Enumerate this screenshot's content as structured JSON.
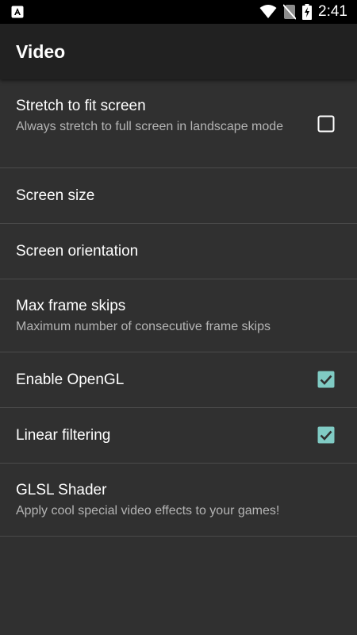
{
  "status_bar": {
    "left_icon": "app-notification-icon",
    "icons": [
      "wifi-icon",
      "no-sim-icon",
      "battery-charging-icon"
    ],
    "time": "2:41"
  },
  "app_bar": {
    "title": "Video"
  },
  "preferences": [
    {
      "title": "Stretch to fit screen",
      "summary": "Always stretch to full screen in landscape mode",
      "checkbox": true,
      "checked": false
    },
    {
      "title": "Screen size",
      "summary": ""
    },
    {
      "title": "Screen orientation",
      "summary": ""
    },
    {
      "title": "Max frame skips",
      "summary": "Maximum number of consecutive frame skips"
    },
    {
      "title": "Enable OpenGL",
      "summary": "",
      "checkbox": true,
      "checked": true
    },
    {
      "title": "Linear filtering",
      "summary": "",
      "checkbox": true,
      "checked": true
    },
    {
      "title": "GLSL Shader",
      "summary": "Apply cool special video effects to your games!"
    }
  ],
  "colors": {
    "background": "#303030",
    "app_bar": "#212121",
    "status_bar": "#000000",
    "accent": "#80cbc4",
    "divider": "#4a4a4a",
    "summary_text": "#b4b4b4"
  }
}
